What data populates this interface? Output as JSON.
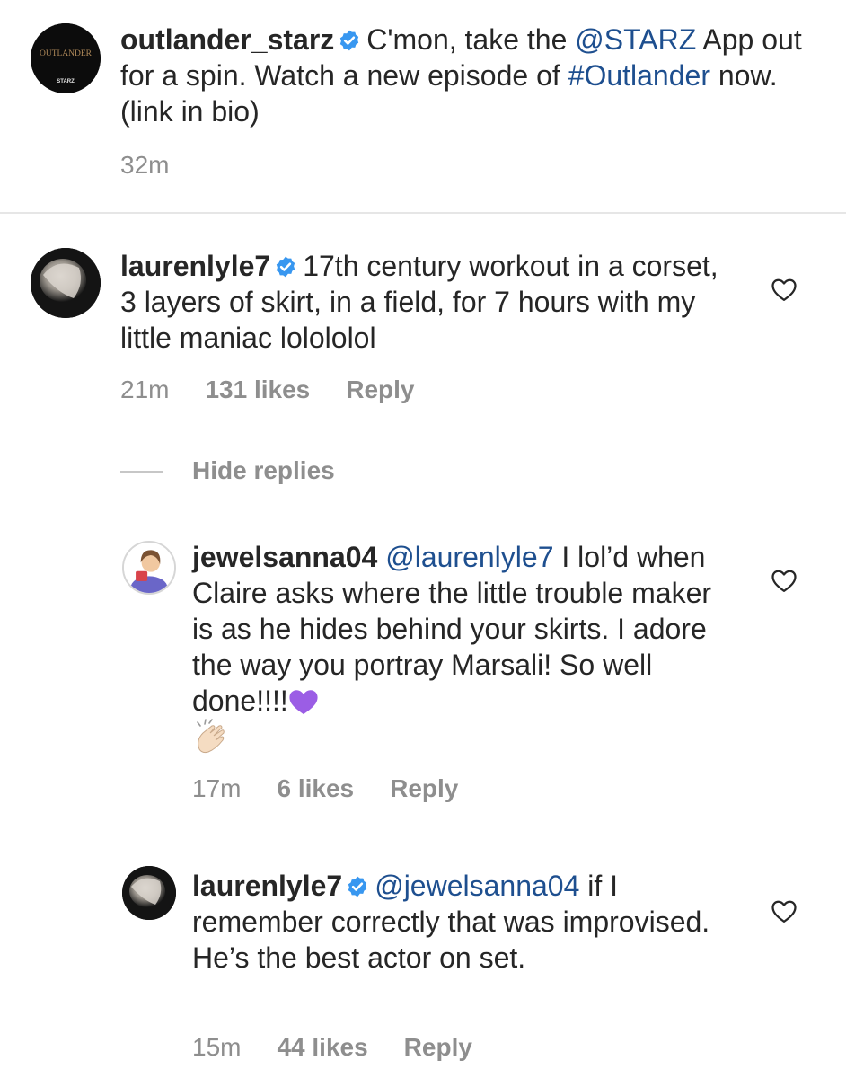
{
  "post": {
    "username": "outlander_starz",
    "verified": true,
    "caption_pre": "C'mon, take the ",
    "mention": "@STARZ",
    "caption_mid": " App out for a spin. Watch a new episode of ",
    "hashtag": "#Outlander",
    "caption_post": " now. (link in bio)",
    "time": "32m",
    "avatar_logo_text": "OUTLANDER",
    "avatar_sub_text": "STARZ"
  },
  "comment": {
    "username": "laurenlyle7",
    "verified": true,
    "text": "17th century workout in a corset, 3 layers of skirt, in a field, for 7 hours with my little maniac lolololol",
    "time": "21m",
    "likes": "131 likes",
    "reply": "Reply",
    "hide_replies": "Hide replies"
  },
  "replies": [
    {
      "username": "jewelsanna04",
      "verified": false,
      "mention": "@laurenlyle7",
      "text": " I lol’d when Claire asks where the little trouble maker is as he hides behind your skirts. I adore the way you portray Marsali! So well done!!!!",
      "emojis": [
        "purple-heart",
        "clapping-hands"
      ],
      "time": "17m",
      "likes": "6 likes",
      "reply": "Reply"
    },
    {
      "username": "laurenlyle7",
      "verified": true,
      "mention": "@jewelsanna04",
      "text": " if I remember correctly that was improvised. He’s the best actor on set.",
      "time": "15m",
      "likes": "44 likes",
      "reply": "Reply"
    }
  ],
  "colors": {
    "text": "#262626",
    "meta": "#8e8e8e",
    "link": "#1e4f8f",
    "verified": "#3897f0",
    "divider": "#e6e6e6",
    "purple_heart": "#9b5de5"
  }
}
